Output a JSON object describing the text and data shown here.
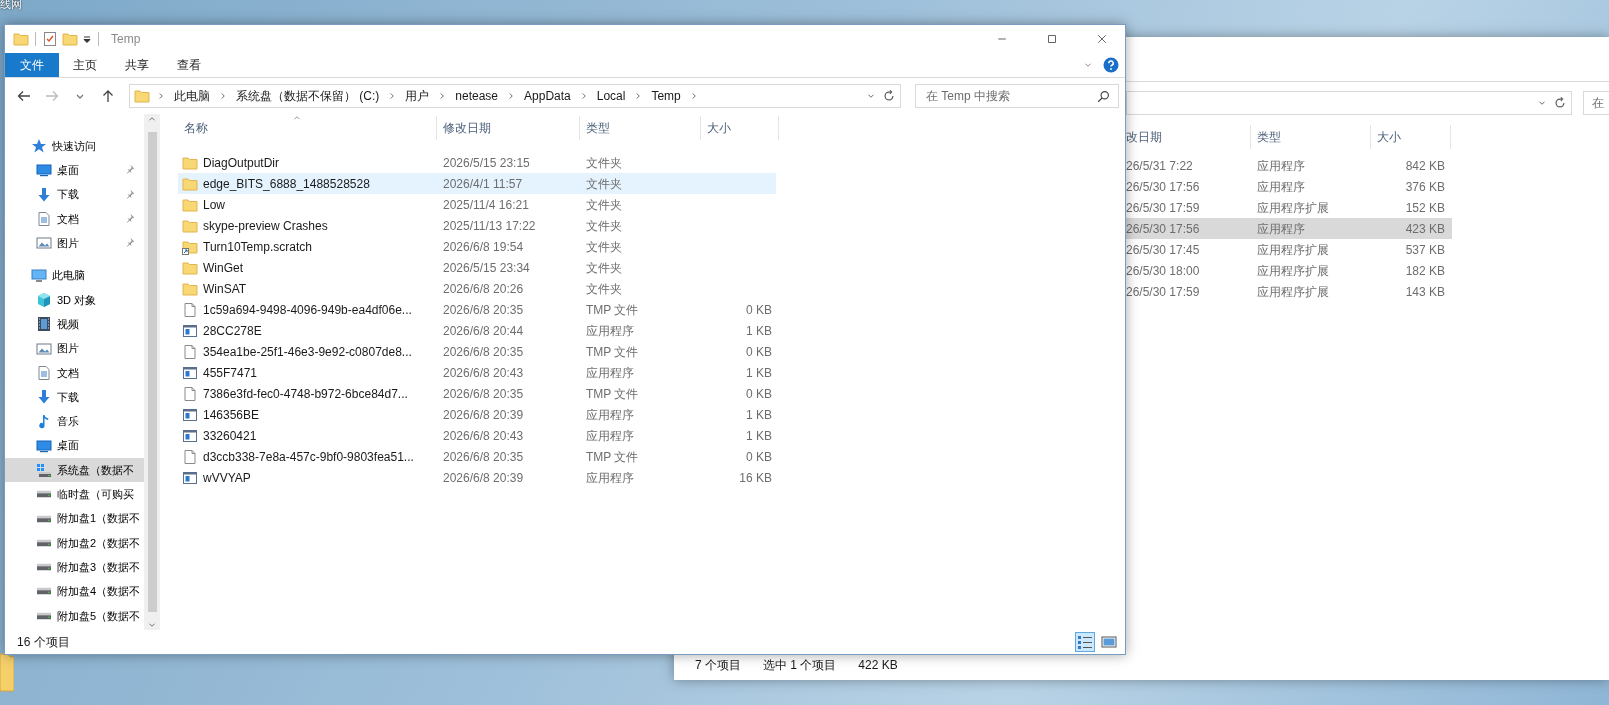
{
  "desktop": {
    "icon_label": "线网"
  },
  "back_window": {
    "search_placeholder": "在",
    "columns": [
      "改日期",
      "类型",
      "大小"
    ],
    "rows": [
      {
        "date": "26/5/31 7:22",
        "type": "应用程序",
        "size": "842 KB",
        "selected": false
      },
      {
        "date": "26/5/30 17:56",
        "type": "应用程序",
        "size": "376 KB",
        "selected": false
      },
      {
        "date": "26/5/30 17:59",
        "type": "应用程序扩展",
        "size": "152 KB",
        "selected": false
      },
      {
        "date": "26/5/30 17:56",
        "type": "应用程序",
        "size": "423 KB",
        "selected": true
      },
      {
        "date": "26/5/30 17:45",
        "type": "应用程序扩展",
        "size": "537 KB",
        "selected": false
      },
      {
        "date": "26/5/30 18:00",
        "type": "应用程序扩展",
        "size": "182 KB",
        "selected": false
      },
      {
        "date": "26/5/30 17:59",
        "type": "应用程序扩展",
        "size": "143 KB",
        "selected": false
      }
    ],
    "status": [
      "7 个项目",
      "选中 1 个项目",
      "422 KB"
    ]
  },
  "window": {
    "title": "Temp",
    "ribbon_tabs": [
      {
        "label": "文件",
        "kind": "file"
      },
      {
        "label": "主页",
        "kind": "tab"
      },
      {
        "label": "共享",
        "kind": "tab"
      },
      {
        "label": "查看",
        "kind": "tab"
      }
    ],
    "address": [
      "此电脑",
      "系统盘（数据不保留） (C:)",
      "用户",
      "netease",
      "AppData",
      "Local",
      "Temp"
    ],
    "search_placeholder": "在 Temp 中搜索",
    "sidebar": [
      {
        "label": "快速访问",
        "kind": "star",
        "children": [
          {
            "label": "桌面",
            "kind": "desktop",
            "pinned": true,
            "selected": false
          },
          {
            "label": "下载",
            "kind": "download",
            "pinned": true,
            "selected": false
          },
          {
            "label": "文档",
            "kind": "document",
            "pinned": true,
            "selected": false
          },
          {
            "label": "图片",
            "kind": "picture",
            "pinned": true,
            "selected": false
          }
        ]
      },
      {
        "label": "此电脑",
        "kind": "pc",
        "children": [
          {
            "label": "3D 对象",
            "kind": "cube",
            "pinned": false,
            "selected": false
          },
          {
            "label": "视频",
            "kind": "video",
            "pinned": false,
            "selected": false
          },
          {
            "label": "图片",
            "kind": "picture",
            "pinned": false,
            "selected": false
          },
          {
            "label": "文档",
            "kind": "document",
            "pinned": false,
            "selected": false
          },
          {
            "label": "下载",
            "kind": "download",
            "pinned": false,
            "selected": false
          },
          {
            "label": "音乐",
            "kind": "music",
            "pinned": false,
            "selected": false
          },
          {
            "label": "桌面",
            "kind": "desktop",
            "pinned": false,
            "selected": false
          },
          {
            "label": "系统盘（数据不",
            "kind": "system-drive",
            "pinned": false,
            "selected": true
          },
          {
            "label": "临时盘（可购买",
            "kind": "drive",
            "pinned": false,
            "selected": false
          },
          {
            "label": "附加盘1（数据不",
            "kind": "drive",
            "pinned": false,
            "selected": false
          },
          {
            "label": "附加盘2（数据不",
            "kind": "drive",
            "pinned": false,
            "selected": false
          },
          {
            "label": "附加盘3（数据不",
            "kind": "drive",
            "pinned": false,
            "selected": false
          },
          {
            "label": "附加盘4（数据不",
            "kind": "drive",
            "pinned": false,
            "selected": false
          },
          {
            "label": "附加盘5（数据不",
            "kind": "drive",
            "pinned": false,
            "selected": false
          }
        ]
      }
    ],
    "columns": [
      "名称",
      "修改日期",
      "类型",
      "大小"
    ],
    "files": [
      {
        "name": "DiagOutputDir",
        "date": "2026/5/15 23:15",
        "type": "文件夹",
        "kind": "folder",
        "highlighted": false
      },
      {
        "name": "edge_BITS_6888_1488528528",
        "date": "2026/4/1 11:57",
        "type": "文件夹",
        "kind": "folder",
        "highlighted": true
      },
      {
        "name": "Low",
        "date": "2025/11/4 16:21",
        "type": "文件夹",
        "kind": "folder",
        "highlighted": false
      },
      {
        "name": "skype-preview Crashes",
        "date": "2025/11/13 17:22",
        "type": "文件夹",
        "kind": "folder",
        "highlighted": false
      },
      {
        "name": "Turn10Temp.scratch",
        "date": "2026/6/8 19:54",
        "type": "文件夹",
        "kind": "folder-shortcut",
        "highlighted": false
      },
      {
        "name": "WinGet",
        "date": "2026/5/15 23:34",
        "type": "文件夹",
        "kind": "folder",
        "highlighted": false
      },
      {
        "name": "WinSAT",
        "date": "2026/6/8 20:26",
        "type": "文件夹",
        "kind": "folder",
        "highlighted": false
      },
      {
        "name": "1c59a694-9498-4096-949b-ea4df06e...",
        "date": "2026/6/8 20:35",
        "type": "TMP 文件",
        "size": "0 KB",
        "kind": "file",
        "highlighted": false
      },
      {
        "name": "28CC278E",
        "date": "2026/6/8 20:44",
        "type": "应用程序",
        "size": "1 KB",
        "kind": "app",
        "highlighted": false
      },
      {
        "name": "354ea1be-25f1-46e3-9e92-c0807de8...",
        "date": "2026/6/8 20:35",
        "type": "TMP 文件",
        "size": "0 KB",
        "kind": "file",
        "highlighted": false
      },
      {
        "name": "455F7471",
        "date": "2026/6/8 20:43",
        "type": "应用程序",
        "size": "1 KB",
        "kind": "app",
        "highlighted": false
      },
      {
        "name": "7386e3fd-fec0-4748-b972-6bce84d7...",
        "date": "2026/6/8 20:35",
        "type": "TMP 文件",
        "size": "0 KB",
        "kind": "file",
        "highlighted": false
      },
      {
        "name": "146356BE",
        "date": "2026/6/8 20:39",
        "type": "应用程序",
        "size": "1 KB",
        "kind": "app",
        "highlighted": false
      },
      {
        "name": "33260421",
        "date": "2026/6/8 20:43",
        "type": "应用程序",
        "size": "1 KB",
        "kind": "app",
        "highlighted": false
      },
      {
        "name": "d3ccb338-7e8a-457c-9bf0-9803fea51...",
        "date": "2026/6/8 20:35",
        "type": "TMP 文件",
        "size": "0 KB",
        "kind": "file",
        "highlighted": false
      },
      {
        "name": "wVVYAP",
        "date": "2026/6/8 20:39",
        "type": "应用程序",
        "size": "16 KB",
        "kind": "app",
        "highlighted": false
      }
    ],
    "status": "16 个项目",
    "view_buttons": [
      {
        "kind": "details",
        "selected": true
      },
      {
        "kind": "large-icons",
        "selected": false
      }
    ]
  }
}
